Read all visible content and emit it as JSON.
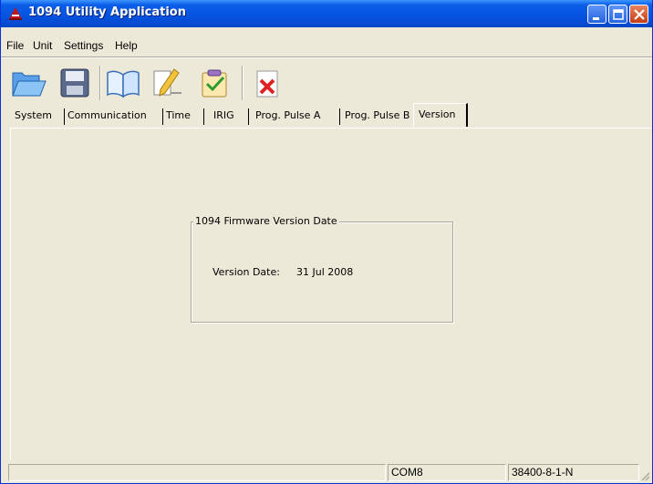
{
  "window": {
    "title": "1094 Utility Application"
  },
  "menu": [
    "File",
    "Unit",
    "Settings",
    "Help"
  ],
  "toolbar": {
    "icons": [
      "open-folder-icon",
      "save-disk-icon",
      "open-book-icon",
      "pencil-edit-icon",
      "clipboard-check-icon",
      "close-x-icon"
    ]
  },
  "tabs": [
    "System",
    "Communication",
    "Time",
    "IRIG",
    "Prog. Pulse A",
    "Prog. Pulse B",
    "Version"
  ],
  "active_tab": "Version",
  "version_group": {
    "legend": "1094 Firmware Version Date",
    "label": "Version Date:",
    "value": "31 Jul 2008"
  },
  "status": {
    "pane1": "",
    "port": "COM8",
    "settings": "38400-8-1-N"
  },
  "colors": {
    "title_bar": "#0553e0",
    "window_face": "#ece9d8",
    "close_button": "#c43c16"
  }
}
